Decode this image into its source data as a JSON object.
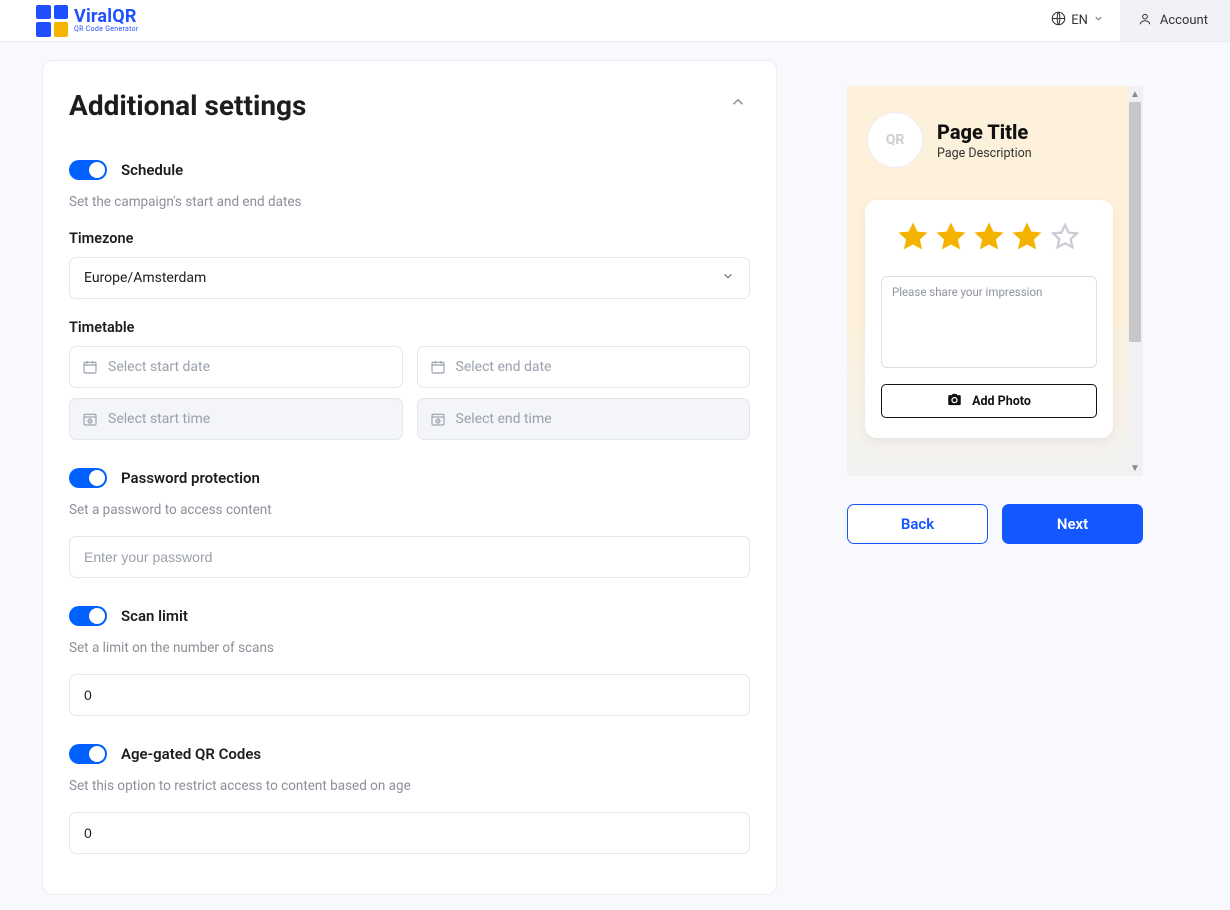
{
  "header": {
    "brand": "ViralQR",
    "brand_sub": "QR Code Generator",
    "lang": "EN",
    "account_label": "Account"
  },
  "settings": {
    "title": "Additional settings",
    "schedule": {
      "label": "Schedule",
      "subtext": "Set the campaign's start and end dates",
      "timezone_label": "Timezone",
      "timezone_value": "Europe/Amsterdam",
      "timetable_label": "Timetable",
      "start_date_placeholder": "Select start date",
      "end_date_placeholder": "Select end date",
      "start_time_placeholder": "Select start time",
      "end_time_placeholder": "Select end time"
    },
    "password": {
      "label": "Password protection",
      "subtext": "Set a password to access content",
      "placeholder": "Enter your password"
    },
    "scan_limit": {
      "label": "Scan limit",
      "subtext": "Set a limit on the number of scans",
      "value": "0"
    },
    "age_gated": {
      "label": "Age-gated QR Codes",
      "subtext": "Set this option to restrict access to content based on age",
      "value": "0"
    }
  },
  "preview": {
    "qr_badge": "QR",
    "title": "Page Title",
    "description": "Page Description",
    "rating_filled": 4,
    "rating_total": 5,
    "impression_placeholder": "Please share your impression",
    "add_photo_label": "Add Photo"
  },
  "nav": {
    "back": "Back",
    "next": "Next"
  }
}
